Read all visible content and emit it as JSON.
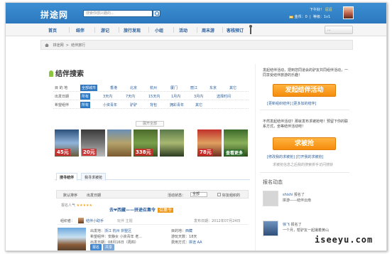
{
  "header": {
    "logo": "拼途网",
    "search_placeholder": "搜索你感兴趣的...",
    "greeting_prefix": "下午好！",
    "username": "迢迢",
    "coins_label": "金币：0",
    "level_label": "等级：1v1"
  },
  "nav": {
    "items": [
      "首页",
      "结伴",
      "游记",
      "旅行发现",
      "小组",
      "活动",
      "周末游",
      "客栈预订"
    ],
    "right_label": "..."
  },
  "breadcrumb": {
    "home": "拼途网",
    "current": "结伴旅行"
  },
  "search_title": "结伴搜索",
  "filters": [
    {
      "label": "目 的 地",
      "options": [
        "全部城市",
        "香港",
        "北京",
        "杭州",
        "厦门",
        "丽江",
        "东京",
        "其它"
      ],
      "selected": 0
    },
    {
      "label": "出发日期",
      "options": [
        "所有",
        "3天内",
        "7天内",
        "15天内",
        "1月内",
        "3月内",
        "选择时间"
      ],
      "selected": 0
    },
    {
      "label": "希望组伴",
      "options": [
        "所有",
        "小资青年",
        "驴驴",
        "背包",
        "拥彩青年",
        "其它"
      ],
      "selected": 0
    }
  ],
  "more_button": "展开全部",
  "thumbnails": [
    {
      "price": "45元",
      "colors": [
        "#2a4f7a",
        "#8fb3d9",
        "#6a5a3a"
      ]
    },
    {
      "price": "20元",
      "colors": [
        "#3a3a3a",
        "#777",
        "#bbb"
      ]
    },
    {
      "price": "",
      "colors": [
        "#6a8fb5",
        "#b4a26a",
        "#7a5a30"
      ]
    },
    {
      "price": "338元",
      "colors": [
        "#4a6a2a",
        "#7aa04a",
        "#3a5020"
      ]
    },
    {
      "price": "",
      "colors": [
        "#5a7a4a",
        "#a8b870",
        "#2a3a20"
      ]
    },
    {
      "price": "78元",
      "colors": [
        "#c0302a",
        "#e0a060",
        "#703020"
      ]
    },
    {
      "price": "查看更多",
      "colors": [
        "#3a6a2a",
        "#8ab05a",
        "#2a4a1a"
      ]
    }
  ],
  "tabs": [
    "搜寻结伴",
    "我寻求被抢"
  ],
  "sort": {
    "default": "默认排序",
    "by_date": "出发日期",
    "status_label": "活动状态：",
    "status_value": "全部",
    "checkbox_label": "好友组织的"
  },
  "rank": {
    "label": "报名人气",
    "stars": "★★★★★"
  },
  "promo": {
    "text": "去❤西藏——拼途召集令",
    "tag": "召集令"
  },
  "org_row": {
    "label": "组织者：",
    "name": "结伴小助手",
    "tags": "玩伴 主题",
    "date_label": "发布日期：2012年07月24日"
  },
  "card": {
    "origin_label": "出发地：",
    "origin_value": "浙江 杭州 拱墅区",
    "dest_label": "目的地：",
    "dest_value": "西藏",
    "hope_label": "希望组伴：",
    "hope_value": "安静女 小资青年 老...",
    "days_label": "游玩天数：",
    "days_value": "18天",
    "date_label": "出发日期：",
    "date_value": "08月16日（周四）",
    "cost_label": "费用方式：",
    "cost_value": "拼途 AA",
    "btn1": "报名",
    "btn2": "共享"
  },
  "sidebar": {
    "intro": "发起结伴活动，把到您同道会的驴友共同组伴活动，一同享受结伴旅游的乐趣！",
    "launch_button": "发起结伴活动",
    "launch_links": "[更新组织结伴] [更多加的结伴]",
    "wait_text": "不然发起结伴活动？那就发布求被抢吧！预留下你的联系方式，坐等结伴活动吧！",
    "ask_button": "求被抢",
    "ask_links": "[修改我的求被抢] [打开我的求被抢]",
    "ask_note": "求被抢信息之后我的搜索拼手访问搜获",
    "signup_title": "报名动态",
    "feed": [
      {
        "user": "shishi",
        "action": "报名了",
        "line2": "拼游——结伴云南",
        "avatar_color": "#cfcfcf"
      },
      {
        "user": "徐飞",
        "action": "报名了",
        "line2": "一个月，帮驴友一起撮着黄山",
        "avatar_color": "#5a7aa0"
      }
    ]
  },
  "watermark": "iseeyu.com"
}
